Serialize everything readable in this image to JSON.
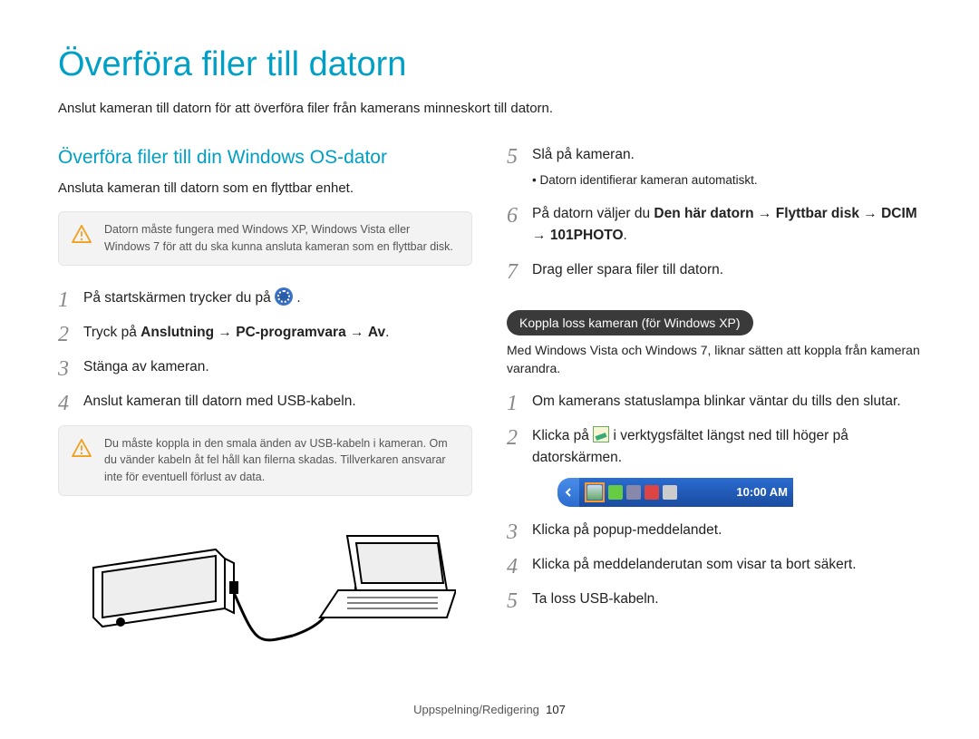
{
  "title": "Överföra filer till datorn",
  "intro": "Anslut kameran till datorn för att överföra filer från kamerans minneskort till datorn.",
  "left": {
    "heading": "Överföra filer till din Windows OS-dator",
    "sub": "Ansluta kameran till datorn som en flyttbar enhet.",
    "note1": "Datorn måste fungera med Windows XP, Windows Vista eller Windows 7 för att du ska kunna ansluta kameran som en flyttbar disk.",
    "steps": {
      "s1_a": "På startskärmen trycker du på ",
      "s1_b": ".",
      "s2_a": "Tryck på ",
      "s2_b": "Anslutning",
      "s2_c": "PC-programvara",
      "s2_d": "Av",
      "s3": "Stänga av kameran.",
      "s4": "Anslut kameran till datorn med USB-kabeln."
    },
    "note2": "Du måste koppla in den smala änden av USB-kabeln i kameran. Om du vänder kabeln åt fel håll kan filerna skadas. Tillverkaren ansvarar inte för eventuell förlust av data."
  },
  "right": {
    "steps": {
      "s5": "Slå på kameran.",
      "s5_sub": "Datorn identifierar kameran automatiskt.",
      "s6_a": "På datorn väljer du ",
      "s6_b": "Den här datorn",
      "s6_c": "Flyttbar disk",
      "s6_d": "DCIM",
      "s6_e": "101PHOTO",
      "s7": "Drag eller spara filer till datorn."
    },
    "pill": "Koppla loss kameran (för Windows XP)",
    "pill_sub": "Med Windows Vista och Windows 7, liknar sätten att koppla från kameran varandra.",
    "dsteps": {
      "s1": "Om kamerans statuslampa blinkar väntar du tills den slutar.",
      "s2_a": "Klicka på ",
      "s2_b": " i verktygsfältet längst ned till höger på datorskärmen.",
      "s3": "Klicka på popup-meddelandet.",
      "s4": "Klicka på meddelanderutan som visar ta bort säkert.",
      "s5": "Ta loss USB-kabeln."
    }
  },
  "arrow": "→",
  "taskbar_time": "10:00 AM",
  "footer_section": "Uppspelning/Redigering",
  "footer_page": "107"
}
